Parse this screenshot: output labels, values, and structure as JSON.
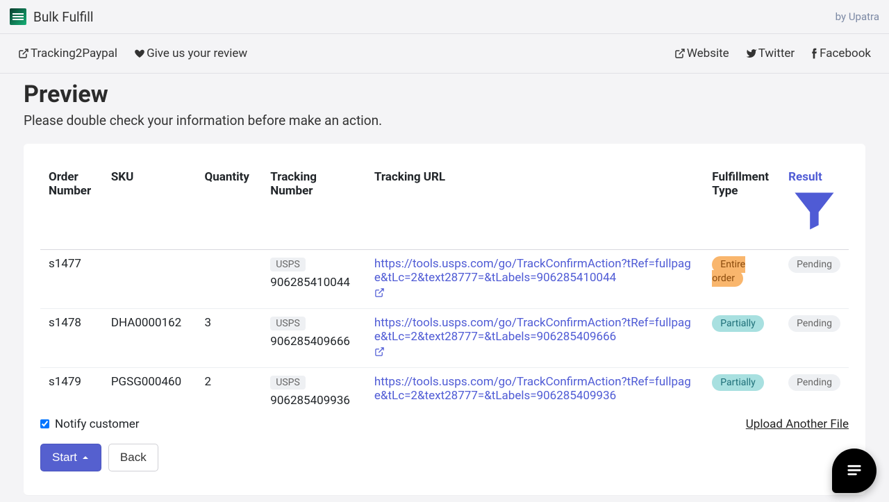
{
  "header": {
    "app_title": "Bulk Fulfill",
    "by_label": "by Upatra"
  },
  "nav": {
    "tracking2paypal": "Tracking2Paypal",
    "review": "Give us your review",
    "website": "Website",
    "twitter": "Twitter",
    "facebook": "Facebook"
  },
  "page": {
    "title": "Preview",
    "subtitle": "Please double check your information before make an action."
  },
  "table": {
    "headers": {
      "order_number": "Order Number",
      "sku": "SKU",
      "quantity": "Quantity",
      "tracking_number": "Tracking Number",
      "tracking_url": "Tracking URL",
      "fulfillment_type": "Fulfillment Type",
      "result": "Result"
    },
    "rows": [
      {
        "order": "s1477",
        "sku": "",
        "quantity": "",
        "carrier": "USPS",
        "tracking_no": "906285410044",
        "tracking_url": "https://tools.usps.com/go/TrackConfirmAction?tRef=fullpage&tLc=2&text28777=&tLabels=906285410044",
        "fulfillment_type": "Entire order",
        "fulfillment_class": "badge-entire",
        "result": "Pending"
      },
      {
        "order": "s1478",
        "sku": "DHA0000162",
        "quantity": "3",
        "carrier": "USPS",
        "tracking_no": "906285409666",
        "tracking_url": "https://tools.usps.com/go/TrackConfirmAction?tRef=fullpage&tLc=2&text28777=&tLabels=906285409666",
        "fulfillment_type": "Partially",
        "fulfillment_class": "badge-partial",
        "result": "Pending"
      },
      {
        "order": "s1479",
        "sku": "PGSG000460",
        "quantity": "2",
        "carrier": "USPS",
        "tracking_no": "906285409936",
        "tracking_url": "https://tools.usps.com/go/TrackConfirmAction?tRef=fullpage&tLc=2&text28777=&tLabels=906285409936",
        "fulfillment_type": "Partially",
        "fulfillment_class": "badge-partial",
        "result": "Pending"
      }
    ]
  },
  "footer": {
    "notify_label": "Notify customer",
    "upload_another": "Upload Another File",
    "start_label": "Start",
    "back_label": "Back"
  }
}
